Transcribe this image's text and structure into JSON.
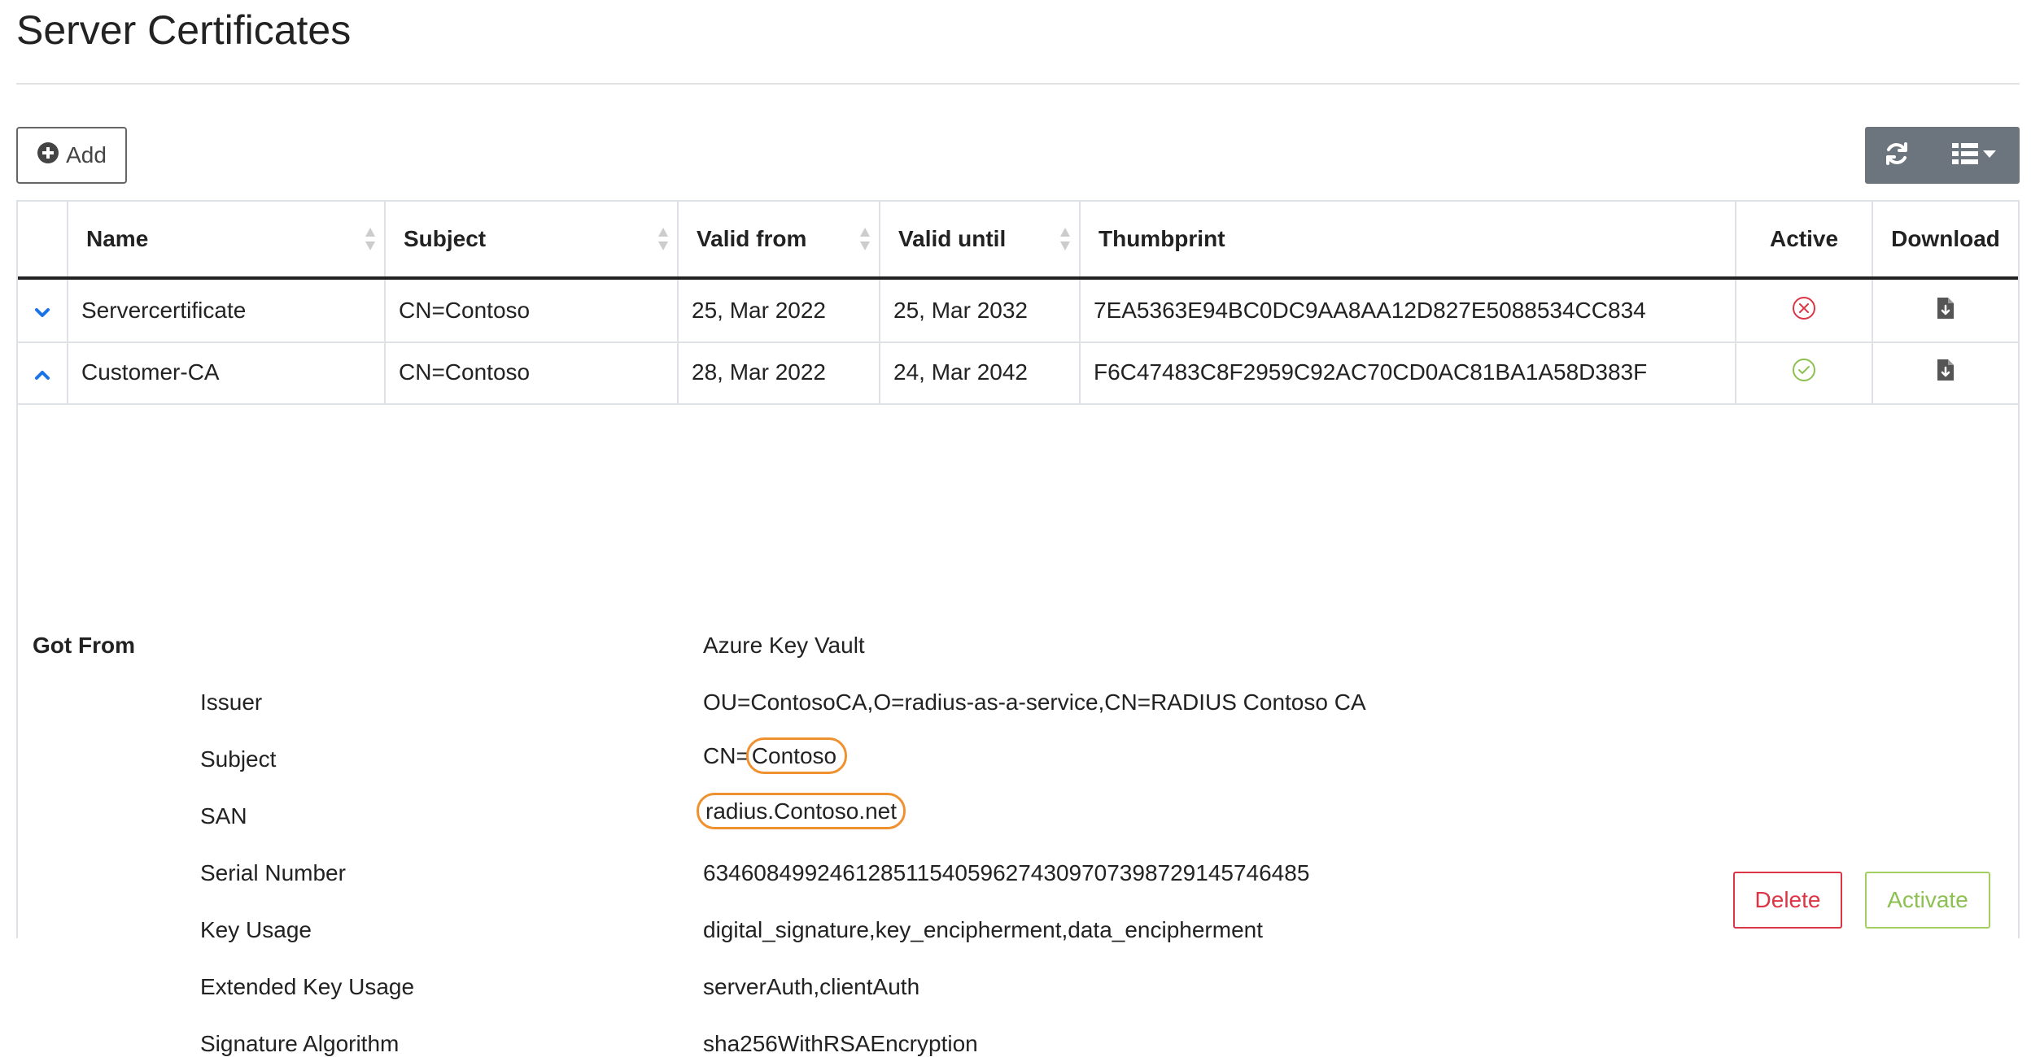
{
  "page": {
    "title": "Server Certificates"
  },
  "toolbar": {
    "add_label": "Add",
    "add_icon": "plus-circle-icon",
    "refresh_icon": "refresh-icon",
    "columns_icon": "list-icon",
    "columns_caret_icon": "caret-down-icon"
  },
  "table": {
    "headers": {
      "name": "Name",
      "subject": "Subject",
      "valid_from": "Valid from",
      "valid_until": "Valid until",
      "thumbprint": "Thumbprint",
      "active": "Active",
      "download": "Download"
    },
    "rows": [
      {
        "expanded": false,
        "name": "Servercertificate",
        "subject": "CN=Contoso",
        "valid_from": "25, Mar 2022",
        "valid_until": "25, Mar 2032",
        "thumbprint": "7EA5363E94BC0DC9AA8AA12D827E5088534CC834",
        "active": false,
        "active_icon": "x-circle-icon",
        "download_icon": "file-download-icon"
      },
      {
        "expanded": true,
        "name": "Customer-CA",
        "subject": "CN=Contoso",
        "valid_from": "28, Mar 2022",
        "valid_until": "24, Mar 2042",
        "thumbprint": "F6C47483C8F2959C92AC70CD0AC81BA1A58D383F",
        "active": true,
        "active_icon": "check-circle-icon",
        "download_icon": "file-download-icon"
      }
    ]
  },
  "details": {
    "got_from": {
      "label": "Got From",
      "value": "Azure Key Vault"
    },
    "issuer": {
      "label": "Issuer",
      "value": "OU=ContosoCA,O=radius-as-a-service,CN=RADIUS Contoso CA"
    },
    "subject": {
      "label": "Subject",
      "prefix": "CN=",
      "value": "Contoso"
    },
    "san": {
      "label": "SAN",
      "value": "radius.Contoso.net"
    },
    "serial": {
      "label": "Serial Number",
      "value": "634608499246128511540596274309707398729145746485"
    },
    "key_usage": {
      "label": "Key Usage",
      "value": "digital_signature,key_encipherment,data_encipherment"
    },
    "ext_key_usage": {
      "label": "Extended Key Usage",
      "value": "serverAuth,clientAuth"
    },
    "sig_alg": {
      "label": "Signature Algorithm",
      "value": "sha256WithRSAEncryption"
    },
    "delete_label": "Delete",
    "activate_label": "Activate"
  },
  "colors": {
    "accent_blue": "#1a73e8",
    "danger": "#dc3545",
    "success": "#8cc152",
    "highlight": "#f0912f",
    "toolbar_bg": "#6c757d"
  }
}
